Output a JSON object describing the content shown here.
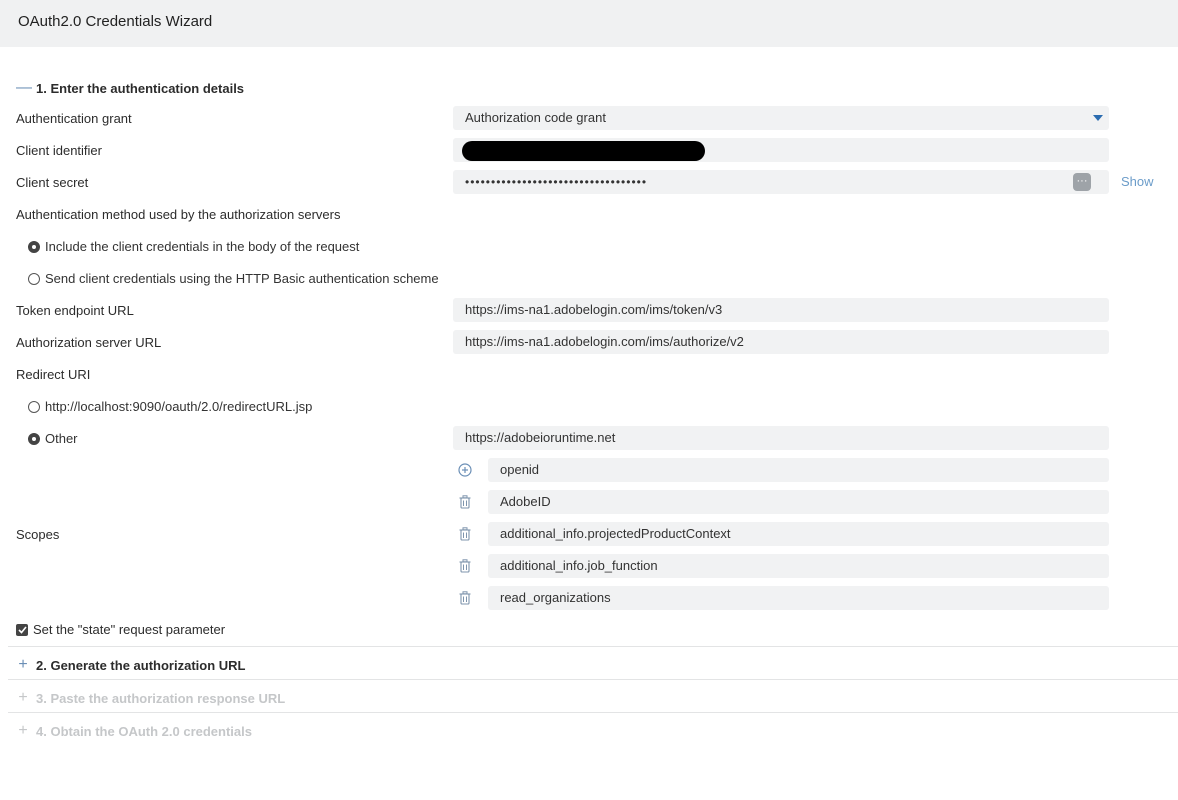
{
  "window": {
    "title": "OAuth2.0 Credentials Wizard"
  },
  "sections": [
    {
      "sign": "—",
      "label": "1. Enter the authentication details"
    },
    {
      "sign": "+",
      "label": "2. Generate the authorization URL"
    },
    {
      "sign": "+",
      "label": "3. Paste the authorization response URL"
    },
    {
      "sign": "+",
      "label": "4. Obtain the OAuth 2.0 credentials"
    }
  ],
  "auth_grant": {
    "label": "Authentication grant",
    "value": "Authorization code grant"
  },
  "client_id": {
    "label": "Client identifier"
  },
  "client_secret": {
    "label": "Client secret",
    "value": "•••••••••••••••••••••••••••••••••••",
    "reveal_icon": "···",
    "show_label": "Show"
  },
  "auth_method": {
    "label": "Authentication method used by the authorization servers",
    "options": [
      {
        "label": "Include the client credentials in the body of the request",
        "checked": true
      },
      {
        "label": "Send client credentials using the HTTP Basic authentication scheme",
        "checked": false
      }
    ]
  },
  "token_endpoint": {
    "label": "Token endpoint URL",
    "value": "https://ims-na1.adobelogin.com/ims/token/v3"
  },
  "auth_server": {
    "label": "Authorization server URL",
    "value": "https://ims-na1.adobelogin.com/ims/authorize/v2"
  },
  "redirect": {
    "label": "Redirect URI",
    "options": [
      {
        "label": "http://localhost:9090/oauth/2.0/redirectURL.jsp",
        "checked": false
      },
      {
        "label": "Other",
        "checked": true
      }
    ],
    "other_value": "https://adobeioruntime.net"
  },
  "scopes": {
    "label": "Scopes",
    "items": [
      "openid",
      "AdobeID",
      "additional_info.projectedProductContext",
      "additional_info.job_function",
      "read_organizations"
    ]
  },
  "state_param": {
    "label": "Set the \"state\" request parameter",
    "checked": true
  }
}
